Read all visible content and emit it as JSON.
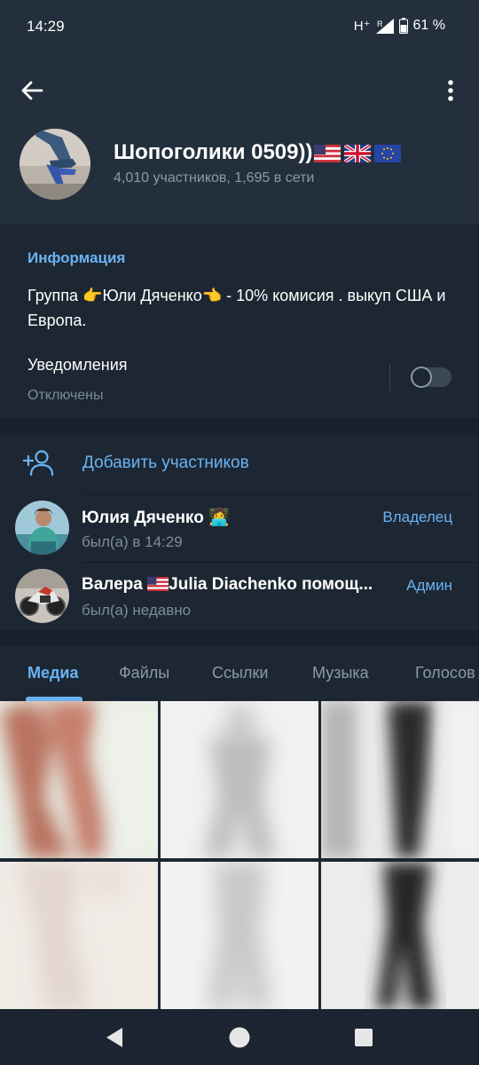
{
  "status_bar": {
    "time": "14:29",
    "network": "H⁺",
    "roaming": "R",
    "battery": "61 %"
  },
  "header": {
    "title": "Шопоголики 0509))",
    "flags": [
      "us-flag-icon",
      "uk-flag-icon",
      "eu-flag-icon"
    ],
    "subtitle": "4,010 участников, 1,695 в сети"
  },
  "info": {
    "heading": "Информация",
    "description": "Группа 👉Юли Дяченко👈 - 10% комисия . выкуп США и Европа.",
    "notifications_label": "Уведомления",
    "notifications_status": "Отключены",
    "notifications_enabled": false
  },
  "members": {
    "add_label": "Добавить участников",
    "list": [
      {
        "name": "Юлия Дяченко 👩‍💻",
        "last_seen": "был(а) в 14:29",
        "role": "Владелец"
      },
      {
        "name_prefix": "Валера ",
        "name_suffix": "Julia Diachenko помощ...",
        "last_seen": "был(а) недавно",
        "role": "Админ"
      }
    ]
  },
  "tabs": [
    "Медиа",
    "Файлы",
    "Ссылки",
    "Музыка",
    "Голосов"
  ],
  "active_tab": "Медиа",
  "colors": {
    "accent": "#6ab3f3",
    "background": "#1d2733",
    "header": "#232f3d"
  }
}
